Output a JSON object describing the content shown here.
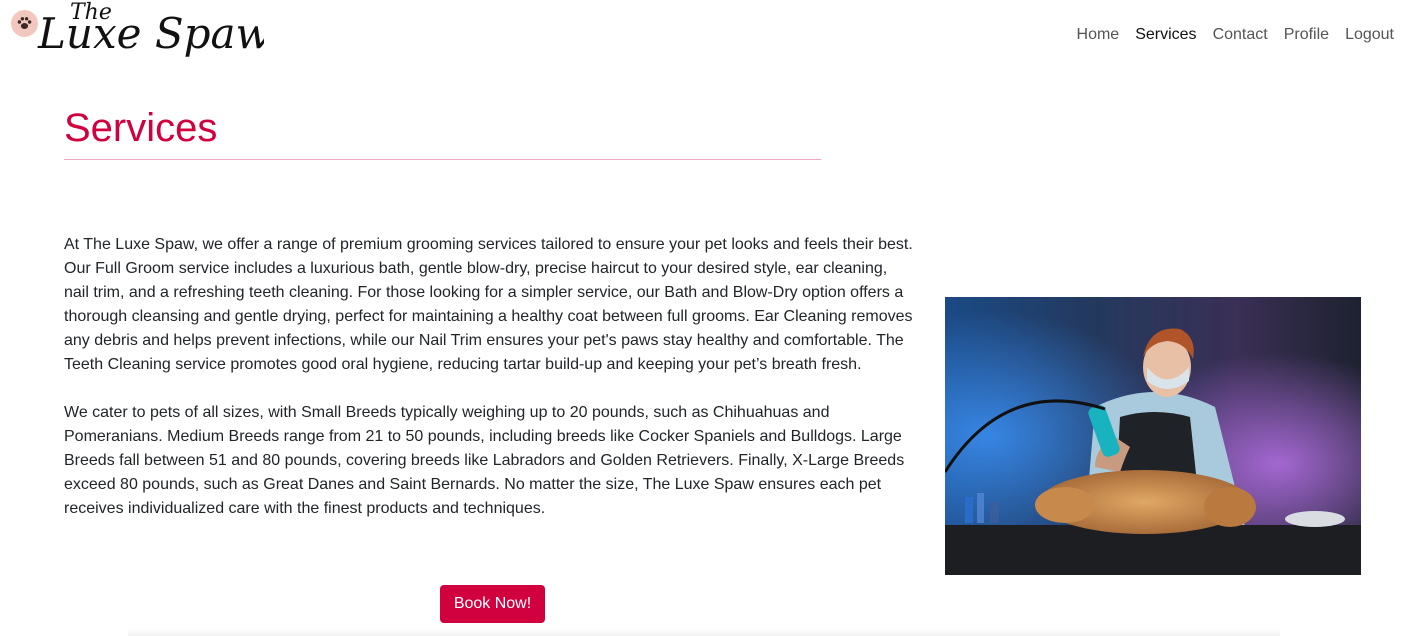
{
  "brand": {
    "line1": "The",
    "line2": "Luxe Spaw",
    "logo_icon": "paw-icon"
  },
  "nav": {
    "items": [
      {
        "label": "Home",
        "active": false
      },
      {
        "label": "Services",
        "active": true
      },
      {
        "label": "Contact",
        "active": false
      },
      {
        "label": "Profile",
        "active": false
      },
      {
        "label": "Logout",
        "active": false
      }
    ]
  },
  "page": {
    "title": "Services",
    "paragraphs": [
      "At The Luxe Spaw, we offer a range of premium grooming services tailored to ensure your pet looks and feels their best. Our Full Groom service includes a luxurious bath, gentle blow-dry, precise haircut to your desired style, ear cleaning, nail trim, and a refreshing teeth cleaning. For those looking for a simpler service, our Bath and Blow-Dry option offers a thorough cleansing and gentle drying, perfect for maintaining a healthy coat between full grooms. Ear Cleaning removes any debris and helps prevent infections, while our Nail Trim ensures your pet's paws stay healthy and comfortable. The Teeth Cleaning service promotes good oral hygiene, reducing tartar build-up and keeping your pet’s breath fresh.",
      "We cater to pets of all sizes, with Small Breeds typically weighing up to 20 pounds, such as Chihuahuas and Pomeranians. Medium Breeds range from 21 to 50 pounds, including breeds like Cocker Spaniels and Bulldogs. Large Breeds fall between 51 and 80 pounds, covering breeds like Labradors and Golden Retrievers. Finally, X-Large Breeds exceed 80 pounds, such as Great Danes and Saint Bernards. No matter the size, The Luxe Spaw ensures each pet receives individualized care with the finest products and techniques."
    ],
    "cta_label": "Book Now!"
  },
  "colors": {
    "accent": "#d1003f",
    "rule": "#f0a9bd",
    "paw_bg": "#f2c7bd"
  }
}
